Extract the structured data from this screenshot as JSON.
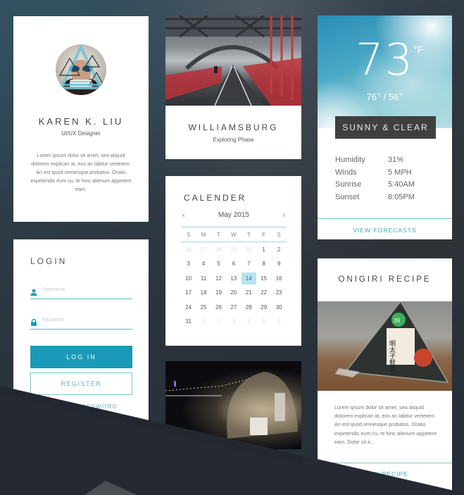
{
  "profile": {
    "name": "KAREN K. LIU",
    "role": "UI/UX Designer",
    "bio": "Lorem ipsum dolor sit amet, sea aliquid dolorem explicari at, eos an labitur verterem. An est quod omnesque probatus. Oratio expetendis eum cu, te hinc alienum appetere eam."
  },
  "login": {
    "title": "LOGIN",
    "username_placeholder": "Username",
    "password_placeholder": "Password",
    "login_label": "LOG IN",
    "register_label": "REGISTER",
    "forgot_label": "FORGOT PASSWORD",
    "icons": {
      "username": "user-icon",
      "password": "lock-icon"
    }
  },
  "williamsburg": {
    "title": "WILLIAMSBURG",
    "subtitle": "Exploring Phase"
  },
  "calendar": {
    "title": "CALENDER",
    "month": "May 2015",
    "prev_icon": "‹",
    "next_icon": "›",
    "weekdays": [
      "S",
      "M",
      "T",
      "W",
      "T",
      "F",
      "S"
    ],
    "weeks": [
      [
        {
          "d": "26",
          "m": true
        },
        {
          "d": "27",
          "m": true
        },
        {
          "d": "28",
          "m": true
        },
        {
          "d": "29",
          "m": true
        },
        {
          "d": "30",
          "m": true
        },
        {
          "d": "1"
        },
        {
          "d": "2"
        }
      ],
      [
        {
          "d": "3"
        },
        {
          "d": "4"
        },
        {
          "d": "5"
        },
        {
          "d": "6"
        },
        {
          "d": "7"
        },
        {
          "d": "8"
        },
        {
          "d": "9"
        }
      ],
      [
        {
          "d": "10"
        },
        {
          "d": "11"
        },
        {
          "d": "12"
        },
        {
          "d": "13"
        },
        {
          "d": "14",
          "sel": true
        },
        {
          "d": "15"
        },
        {
          "d": "16"
        }
      ],
      [
        {
          "d": "17"
        },
        {
          "d": "18"
        },
        {
          "d": "19"
        },
        {
          "d": "20"
        },
        {
          "d": "21"
        },
        {
          "d": "22"
        },
        {
          "d": "23"
        }
      ],
      [
        {
          "d": "24"
        },
        {
          "d": "25"
        },
        {
          "d": "26"
        },
        {
          "d": "27"
        },
        {
          "d": "28"
        },
        {
          "d": "29"
        },
        {
          "d": "30"
        }
      ],
      [
        {
          "d": "31"
        },
        {
          "d": "1",
          "m": true
        },
        {
          "d": "2",
          "m": true
        },
        {
          "d": "3",
          "m": true
        },
        {
          "d": "4",
          "m": true
        },
        {
          "d": "5",
          "m": true
        },
        {
          "d": "6",
          "m": true
        }
      ]
    ]
  },
  "weather": {
    "temp": "73",
    "unit": "°F",
    "high": "76",
    "low": "56",
    "hi_unit": "°F",
    "condition": "SUNNY & CLEAR",
    "stats": [
      {
        "label": "Humidity",
        "value": "31%"
      },
      {
        "label": "Winds",
        "value": "5 MPH"
      },
      {
        "label": "Sunrise",
        "value": "5:40AM"
      },
      {
        "label": "Sunset",
        "value": "8:05PM"
      }
    ],
    "forecast_label": "VIEW FORECASTS"
  },
  "onigiri": {
    "title": "ONIGIRI RECIPE",
    "text": "Lorem ipsum dolor sit amet, sea aliquid dolorem explicari at, eos an labitur verterem. An est quod omnesque probatus. Oratio expetendis eum cu, te hinc alienum appetere eam. Dolor sit a...",
    "link_label": "VIEW RECIPE",
    "label_text": "明太子鮭魚",
    "sticker_text": "39"
  },
  "colors": {
    "accent": "#1a9ab8",
    "accent_light": "#7cc5d2",
    "dark": "#252a32",
    "condition_bg": "#3f3f3f"
  }
}
